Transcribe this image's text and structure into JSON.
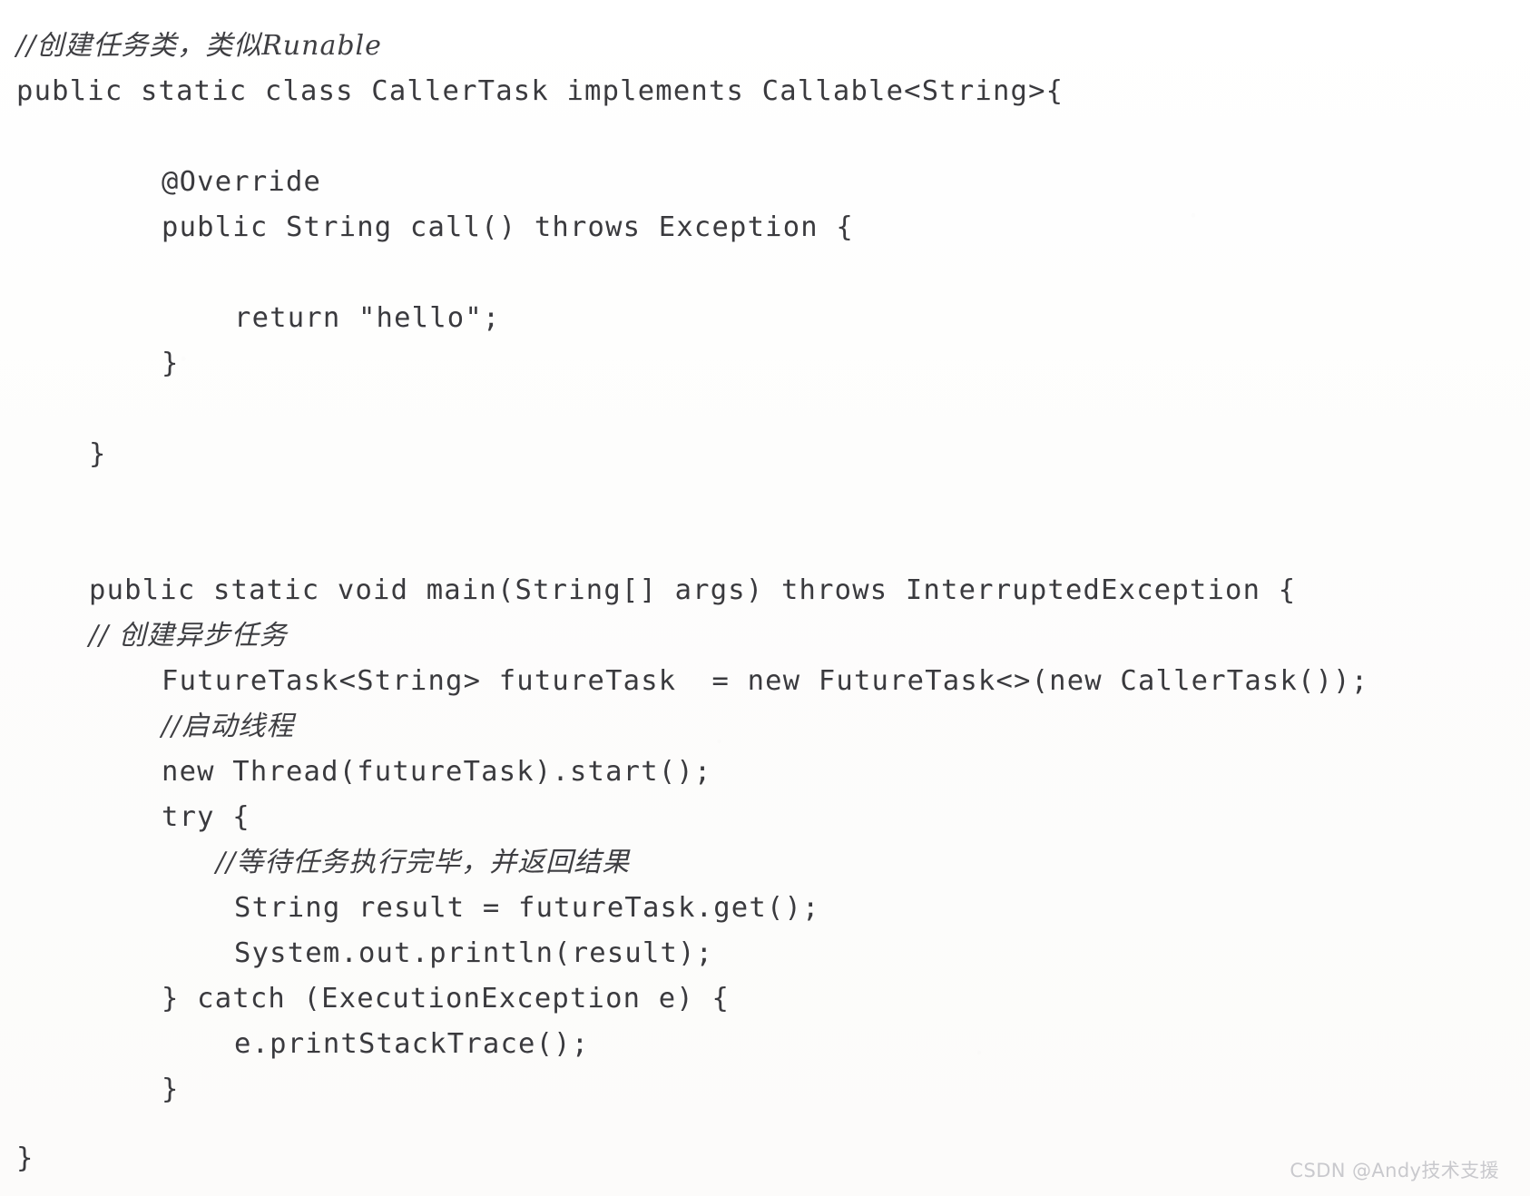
{
  "document": {
    "kind": "scanned-code-listing",
    "language": "Java",
    "text_color": "#3a3a3e",
    "background_color": "#ffffff",
    "lines": [
      {
        "id": "l1",
        "type": "comment-cn",
        "indent": 0,
        "text": "//创建任务类，类似Runable"
      },
      {
        "id": "l2",
        "type": "code",
        "indent": 0,
        "text": "public static class CallerTask implements Callable<String>{"
      },
      {
        "id": "l3",
        "type": "blank",
        "indent": 0,
        "text": ""
      },
      {
        "id": "l4",
        "type": "code",
        "indent": 4,
        "text": "@Override"
      },
      {
        "id": "l5",
        "type": "code",
        "indent": 4,
        "text": "public String call() throws Exception {"
      },
      {
        "id": "l6",
        "type": "blank",
        "indent": 0,
        "text": ""
      },
      {
        "id": "l7",
        "type": "code",
        "indent": 6,
        "text": "return \"hello\";"
      },
      {
        "id": "l8",
        "type": "code",
        "indent": 4,
        "text": "}"
      },
      {
        "id": "l9",
        "type": "blank",
        "indent": 0,
        "text": ""
      },
      {
        "id": "l10",
        "type": "blank",
        "indent": 0,
        "text": ""
      },
      {
        "id": "l11",
        "type": "code",
        "indent": 2,
        "text": "}"
      },
      {
        "id": "l12",
        "type": "blank",
        "indent": 0,
        "text": ""
      },
      {
        "id": "l13",
        "type": "blank",
        "indent": 0,
        "text": ""
      },
      {
        "id": "l14",
        "type": "code",
        "indent": 2,
        "text": "public static void main(String[] args) throws InterruptedException {"
      },
      {
        "id": "l15",
        "type": "comment-cn",
        "indent": 2,
        "text": "// 创建异步任务"
      },
      {
        "id": "l16",
        "type": "code",
        "indent": 4,
        "text": "FutureTask<String> futureTask  = new FutureTask<>(new CallerTask());"
      },
      {
        "id": "l17",
        "type": "comment-cn",
        "indent": 4,
        "text": "//启动线程"
      },
      {
        "id": "l18",
        "type": "code",
        "indent": 4,
        "text": "new Thread(futureTask).start();"
      },
      {
        "id": "l19",
        "type": "code",
        "indent": 4,
        "text": "try {"
      },
      {
        "id": "l20",
        "type": "comment-cn",
        "indent": 5,
        "text": "//等待任务执行完毕，并返回结果"
      },
      {
        "id": "l21",
        "type": "code",
        "indent": 6,
        "text": "String result = futureTask.get();"
      },
      {
        "id": "l22",
        "type": "code",
        "indent": 6,
        "text": "System.out.println(result);"
      },
      {
        "id": "l23",
        "type": "code",
        "indent": 4,
        "text": "} catch (ExecutionException e) {"
      },
      {
        "id": "l24",
        "type": "code",
        "indent": 6,
        "text": "e.printStackTrace();"
      },
      {
        "id": "l25",
        "type": "code",
        "indent": 4,
        "text": "}"
      },
      {
        "id": "l26",
        "type": "blank-sm",
        "indent": 0,
        "text": ""
      },
      {
        "id": "l27",
        "type": "code",
        "indent": 0,
        "text": "}"
      }
    ]
  },
  "watermark": {
    "text": "CSDN @Andy技术支援",
    "color": "#c9c9cd"
  }
}
